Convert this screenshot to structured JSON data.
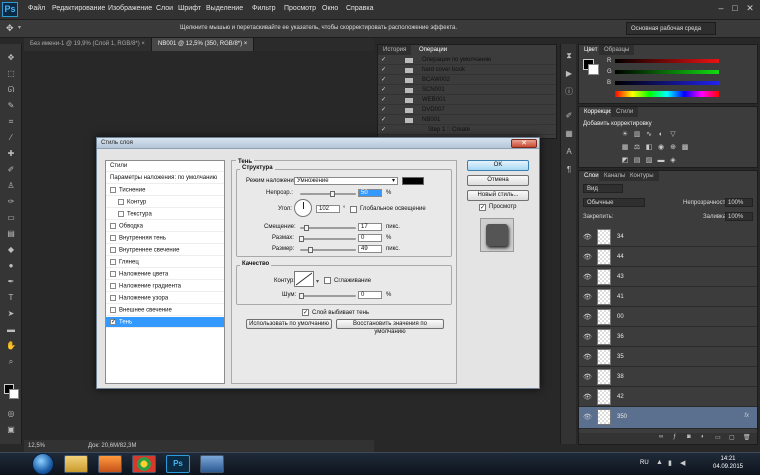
{
  "menubar": {
    "logo": "Ps",
    "items": [
      "Файл",
      "Редактирование",
      "Изображение",
      "Слои",
      "Шрифт",
      "Выделение",
      "Фильтр",
      "Просмотр",
      "Окно",
      "Справка"
    ]
  },
  "options": {
    "hint": "Щелкните мышью и перетаскивайте ее указатель, чтобы скорректировать расположение эффекта.",
    "workspace": "Основная рабочая среда"
  },
  "doctabs": [
    {
      "label": "Без имени-1 @ 19,9% (Слой 1, RGB/8*) ×",
      "active": false
    },
    {
      "label": "NB001 @ 12,5% (350, RGB/8*) ×",
      "active": true
    }
  ],
  "status": {
    "zoom": "12,5%",
    "doc": "Док: 20,6M/82,3M"
  },
  "history": {
    "tabs": [
      "История",
      "Операции"
    ],
    "rows": [
      "Операции по умолчанию",
      "hard cover book",
      "BCAW002",
      "SCN001",
      "WEB001",
      "DVD007",
      "NB001",
      "Step 1 :: Create"
    ]
  },
  "color": {
    "tabs": [
      "Цвет",
      "Образцы"
    ],
    "labels": [
      "R",
      "G",
      "B"
    ]
  },
  "adjust": {
    "tabs": [
      "Коррекция",
      "Стили"
    ],
    "title": "Добавить корректировку"
  },
  "layers": {
    "tabs": [
      "Слои",
      "Каналы",
      "Контуры"
    ],
    "kind": "Вид",
    "blend": "Обычные",
    "opacity_label": "Непрозрачность:",
    "opacity": "100%",
    "lock_label": "Закрепить:",
    "fill_label": "Заливка:",
    "fill": "100%",
    "rows": [
      "34",
      "44",
      "43",
      "41",
      "00",
      "36",
      "35",
      "38",
      "42",
      "350"
    ],
    "fx": "fx"
  },
  "dialog": {
    "title": "Стиль слоя",
    "list": [
      "Стили",
      "Параметры наложения: по умолчанию",
      "Тиснение",
      "Контур",
      "Текстура",
      "Обводка",
      "Внутренняя тень",
      "Внутреннее свечение",
      "Глянец",
      "Наложение цвета",
      "Наложение градиента",
      "Наложение узора",
      "Внешнее свечение",
      "Тень"
    ],
    "section": "Тень",
    "structure": "Структура",
    "blend_label": "Режим наложения:",
    "blend_value": "Умножение",
    "opacity_label": "Непрозр.:",
    "opacity": "50",
    "unit_pct": "%",
    "angle_label": "Угол:",
    "angle": "102",
    "deg": "°",
    "global_light": "Глобальное освещение",
    "distance_label": "Смещение:",
    "distance": "17",
    "size_unit": "пикс.",
    "spread_label": "Размах:",
    "spread": "0",
    "size_label": "Размер:",
    "size": "49",
    "quality": "Качество",
    "contour_label": "Контур:",
    "antialias": "Сглаживание",
    "noise_label": "Шум:",
    "noise": "0",
    "knockout": "Слой выбивает тень",
    "btn_default": "Использовать по умолчанию",
    "btn_reset": "Восстановить значения по умолчанию",
    "ok": "OK",
    "cancel": "Отмена",
    "new_style": "Новый стиль...",
    "preview": "Просмотр"
  },
  "taskbar": {
    "lang": "RU",
    "time": "14:21",
    "date": "04.09.2015"
  }
}
